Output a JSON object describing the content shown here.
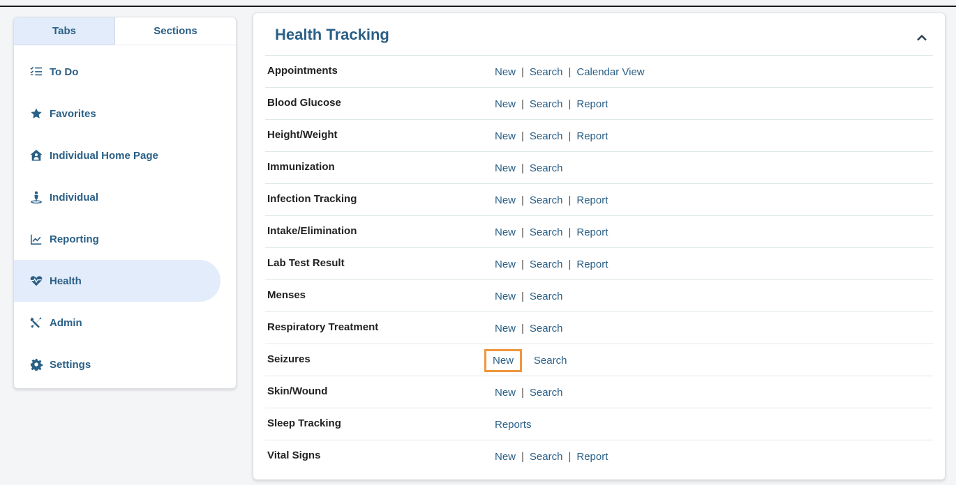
{
  "sidebar": {
    "tabs": [
      {
        "label": "Tabs",
        "active": true
      },
      {
        "label": "Sections",
        "active": false
      }
    ],
    "items": [
      {
        "label": "To Do",
        "icon": "todo-list-icon"
      },
      {
        "label": "Favorites",
        "icon": "star-icon"
      },
      {
        "label": "Individual Home Page",
        "icon": "home-person-icon"
      },
      {
        "label": "Individual",
        "icon": "person-icon"
      },
      {
        "label": "Reporting",
        "icon": "chart-line-icon"
      },
      {
        "label": "Health",
        "icon": "heart-pulse-icon",
        "active": true
      },
      {
        "label": "Admin",
        "icon": "tools-icon"
      },
      {
        "label": "Settings",
        "icon": "gear-icon"
      }
    ]
  },
  "main": {
    "title": "Health Tracking",
    "rows": [
      {
        "label": "Appointments",
        "links": [
          "New",
          "Search",
          "Calendar View"
        ]
      },
      {
        "label": "Blood Glucose",
        "links": [
          "New",
          "Search",
          "Report"
        ]
      },
      {
        "label": "Height/Weight",
        "links": [
          "New",
          "Search",
          "Report"
        ]
      },
      {
        "label": "Immunization",
        "links": [
          "New",
          "Search"
        ]
      },
      {
        "label": "Infection Tracking",
        "links": [
          "New",
          "Search",
          "Report"
        ]
      },
      {
        "label": "Intake/Elimination",
        "links": [
          "New",
          "Search",
          "Report"
        ]
      },
      {
        "label": "Lab Test Result",
        "links": [
          "New",
          "Search",
          "Report"
        ]
      },
      {
        "label": "Menses",
        "links": [
          "New",
          "Search"
        ]
      },
      {
        "label": "Respiratory Treatment",
        "links": [
          "New",
          "Search"
        ]
      },
      {
        "label": "Seizures",
        "links": [
          "New",
          "Search"
        ],
        "highlighted_link": "New"
      },
      {
        "label": "Skin/Wound",
        "links": [
          "New",
          "Search"
        ]
      },
      {
        "label": "Sleep Tracking",
        "links": [
          "Reports"
        ]
      },
      {
        "label": "Vital Signs",
        "links": [
          "New",
          "Search",
          "Report"
        ]
      }
    ]
  },
  "colors": {
    "accent": "#2a5f86",
    "active_bg": "#e3ecfa",
    "highlight": "#f0963e"
  },
  "separator": "|"
}
